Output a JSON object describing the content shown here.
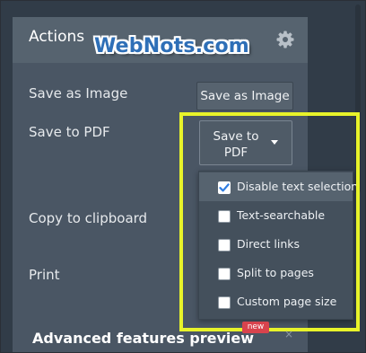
{
  "panel": {
    "title": "Actions",
    "settings_icon": "gear-icon"
  },
  "watermark": "WebNots.com",
  "rows": {
    "save_image_label": "Save as Image",
    "save_image_button": "Save as Image",
    "save_pdf_label": "Save to PDF",
    "save_pdf_button_line1": "Save to",
    "save_pdf_button_line2": "PDF",
    "copy_label": "Copy to clipboard",
    "print_label": "Print"
  },
  "dropdown": {
    "options": [
      {
        "label": "Disable text selection",
        "checked": true
      },
      {
        "label": "Text-searchable",
        "checked": false
      },
      {
        "label": "Direct links",
        "checked": false
      },
      {
        "label": "Split to pages",
        "checked": false
      },
      {
        "label": "Custom page size",
        "checked": false
      }
    ]
  },
  "advanced": {
    "title": "Advanced features preview",
    "badge": "new",
    "close": "×"
  },
  "colors": {
    "highlight": "#e8f32a",
    "check": "#2f7de1",
    "badge": "#d8434d"
  }
}
